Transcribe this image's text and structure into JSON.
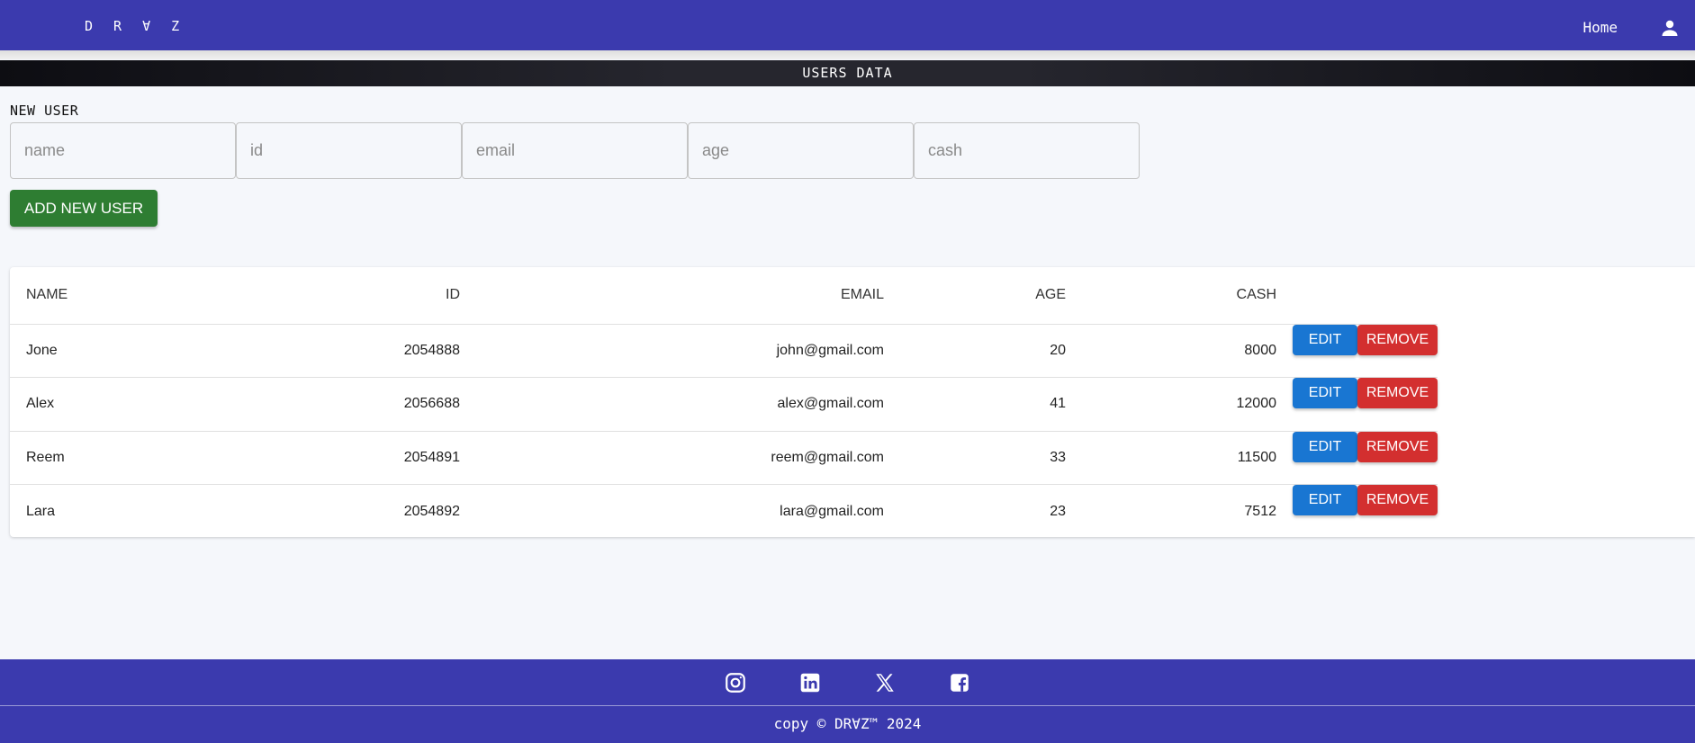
{
  "navbar": {
    "logo": "D R ∀ Z",
    "home_label": "Home",
    "bg_color": "#3b3aae"
  },
  "title_bar": {
    "title": "USERS DATA"
  },
  "new_user_form": {
    "section_label": "NEW USER",
    "placeholders": {
      "name": "name",
      "id": "id",
      "email": "email",
      "age": "age",
      "cash": "cash"
    },
    "add_button_label": "ADD NEW USER"
  },
  "table": {
    "headers": {
      "name": "NAME",
      "id": "ID",
      "email": "EMAIL",
      "age": "AGE",
      "cash": "CASH"
    },
    "edit_label": "EDIT",
    "remove_label": "REMOVE",
    "rows": [
      {
        "name": "Jone",
        "id": "2054888",
        "email": "john@gmail.com",
        "age": "20",
        "cash": "8000"
      },
      {
        "name": "Alex",
        "id": "2056688",
        "email": "alex@gmail.com",
        "age": "41",
        "cash": "12000"
      },
      {
        "name": "Reem",
        "id": "2054891",
        "email": "reem@gmail.com",
        "age": "33",
        "cash": "11500"
      },
      {
        "name": "Lara",
        "id": "2054892",
        "email": "lara@gmail.com",
        "age": "23",
        "cash": "7512"
      }
    ]
  },
  "footer": {
    "social_icons": [
      "instagram-icon",
      "linkedin-icon",
      "x-icon",
      "facebook-icon"
    ],
    "copyright": "copy © DR∀Z™ 2024"
  },
  "colors": {
    "primary": "#3b3aae",
    "add_button": "#2e7d32",
    "edit_button": "#1976d2",
    "remove_button": "#d32f2f"
  }
}
